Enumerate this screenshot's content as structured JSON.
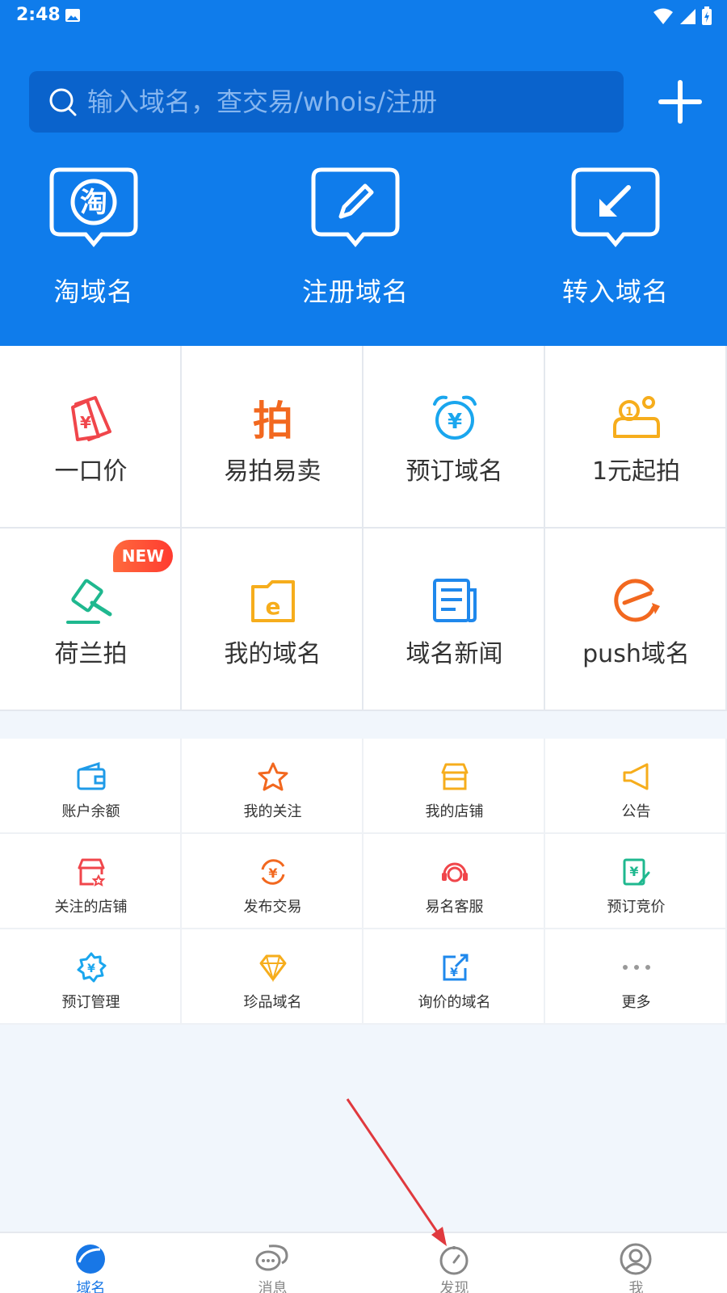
{
  "status": {
    "time": "2:48"
  },
  "search": {
    "placeholder": "输入域名，查交易/whois/注册"
  },
  "quick_actions": [
    {
      "label": "淘域名",
      "icon": "tao-chat-icon"
    },
    {
      "label": "注册域名",
      "icon": "pencil-chat-icon"
    },
    {
      "label": "转入域名",
      "icon": "arrow-in-chat-icon"
    }
  ],
  "big_grid": [
    {
      "label": "一口价",
      "icon": "price-tag-icon",
      "color": "#f0464b"
    },
    {
      "label": "易拍易卖",
      "icon": "pai-char-icon",
      "color": "#f2681f"
    },
    {
      "label": "预订域名",
      "icon": "alarm-clock-icon",
      "color": "#1aa6ee"
    },
    {
      "label": "1元起拍",
      "icon": "coin-hand-icon",
      "color": "#f6ad1c"
    },
    {
      "label": "荷兰拍",
      "icon": "auction-hammer-icon",
      "color": "#1fb88f",
      "badge": "NEW"
    },
    {
      "label": "我的域名",
      "icon": "e-folder-icon",
      "color": "#f6ad1c"
    },
    {
      "label": "域名新闻",
      "icon": "news-icon",
      "color": "#1f88ec"
    },
    {
      "label": "push域名",
      "icon": "push-icon",
      "color": "#f2681f"
    }
  ],
  "small_grid": [
    {
      "label": "账户余额",
      "icon": "wallet-icon",
      "color": "#1f9be8"
    },
    {
      "label": "我的关注",
      "icon": "star-icon",
      "color": "#f2681f"
    },
    {
      "label": "我的店铺",
      "icon": "store-icon",
      "color": "#f6ad1c"
    },
    {
      "label": "公告",
      "icon": "megaphone-icon",
      "color": "#f6ad1c"
    },
    {
      "label": "关注的店铺",
      "icon": "store-star-icon",
      "color": "#f0464b"
    },
    {
      "label": "发布交易",
      "icon": "yuan-cycle-icon",
      "color": "#f2681f"
    },
    {
      "label": "易名客服",
      "icon": "headset-icon",
      "color": "#f0464b"
    },
    {
      "label": "预订竞价",
      "icon": "yuan-edit-icon",
      "color": "#1fb88f"
    },
    {
      "label": "预订管理",
      "icon": "yuan-gear-icon",
      "color": "#1aa6ee"
    },
    {
      "label": "珍品域名",
      "icon": "diamond-icon",
      "color": "#f6ad1c"
    },
    {
      "label": "询价的域名",
      "icon": "yuan-share-icon",
      "color": "#1f88ec"
    },
    {
      "label": "更多",
      "icon": "more-dots-icon",
      "color": "#999999"
    }
  ],
  "bottom_nav": [
    {
      "label": "域名",
      "icon": "globe-icon",
      "active": true
    },
    {
      "label": "消息",
      "icon": "chat-bubbles-icon",
      "active": false
    },
    {
      "label": "发现",
      "icon": "compass-icon",
      "active": false
    },
    {
      "label": "我",
      "icon": "user-icon",
      "active": false
    }
  ],
  "colors": {
    "brand": "#0f7ceb",
    "nav_active": "#1877e6",
    "annotation_arrow": "#e0393e"
  }
}
